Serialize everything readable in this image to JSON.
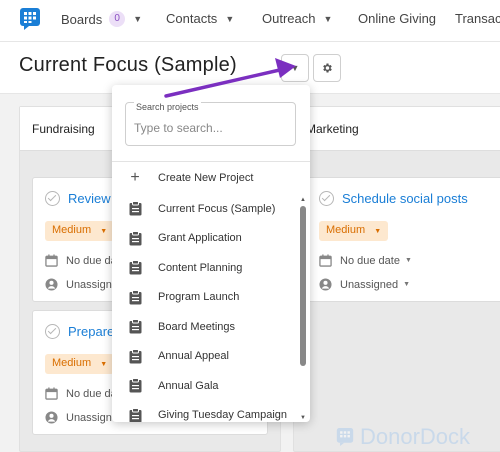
{
  "nav": {
    "items": [
      {
        "label": "Boards",
        "badge": "0",
        "has_chevron": true
      },
      {
        "label": "Contacts",
        "has_chevron": true
      },
      {
        "label": "Outreach",
        "has_chevron": true
      },
      {
        "label": "Online Giving",
        "has_chevron": false
      },
      {
        "label": "Transac",
        "has_chevron": false
      }
    ]
  },
  "header": {
    "title": "Current Focus (Sample)"
  },
  "columns": [
    {
      "name": "Fundraising",
      "cards": [
        {
          "title": "Review c",
          "priority": "Medium",
          "due": "No due da",
          "assignee": "Unassign"
        },
        {
          "title": "Prepare",
          "priority": "Medium",
          "due": "No due da",
          "assignee": "Unassign"
        }
      ]
    },
    {
      "name": "Marketing",
      "cards": [
        {
          "title": "Schedule social posts",
          "priority": "Medium",
          "due": "No due date",
          "assignee": "Unassigned"
        }
      ]
    }
  ],
  "dropdown": {
    "search_label": "Search projects",
    "search_placeholder": "Type to search...",
    "create_label": "Create New Project",
    "projects": [
      "Current Focus (Sample)",
      "Grant Application",
      "Content Planning",
      "Program Launch",
      "Board Meetings",
      "Annual Appeal",
      "Annual Gala",
      "Giving Tuesday Campaign"
    ]
  },
  "watermark": "DonorDock",
  "colors": {
    "accent": "#1a7ed6",
    "priority_bg": "#fde8cf",
    "priority_text": "#d96e00",
    "arrow": "#7b2fc0",
    "badge_bg": "#ecdff7"
  },
  "icons": {
    "logo": "chat-grid-logo-icon",
    "settings": "gear-icon",
    "complete": "check-circle-icon",
    "due": "calendar-icon",
    "assignee": "person-icon",
    "create": "plus-icon",
    "project": "clipboard-icon"
  }
}
